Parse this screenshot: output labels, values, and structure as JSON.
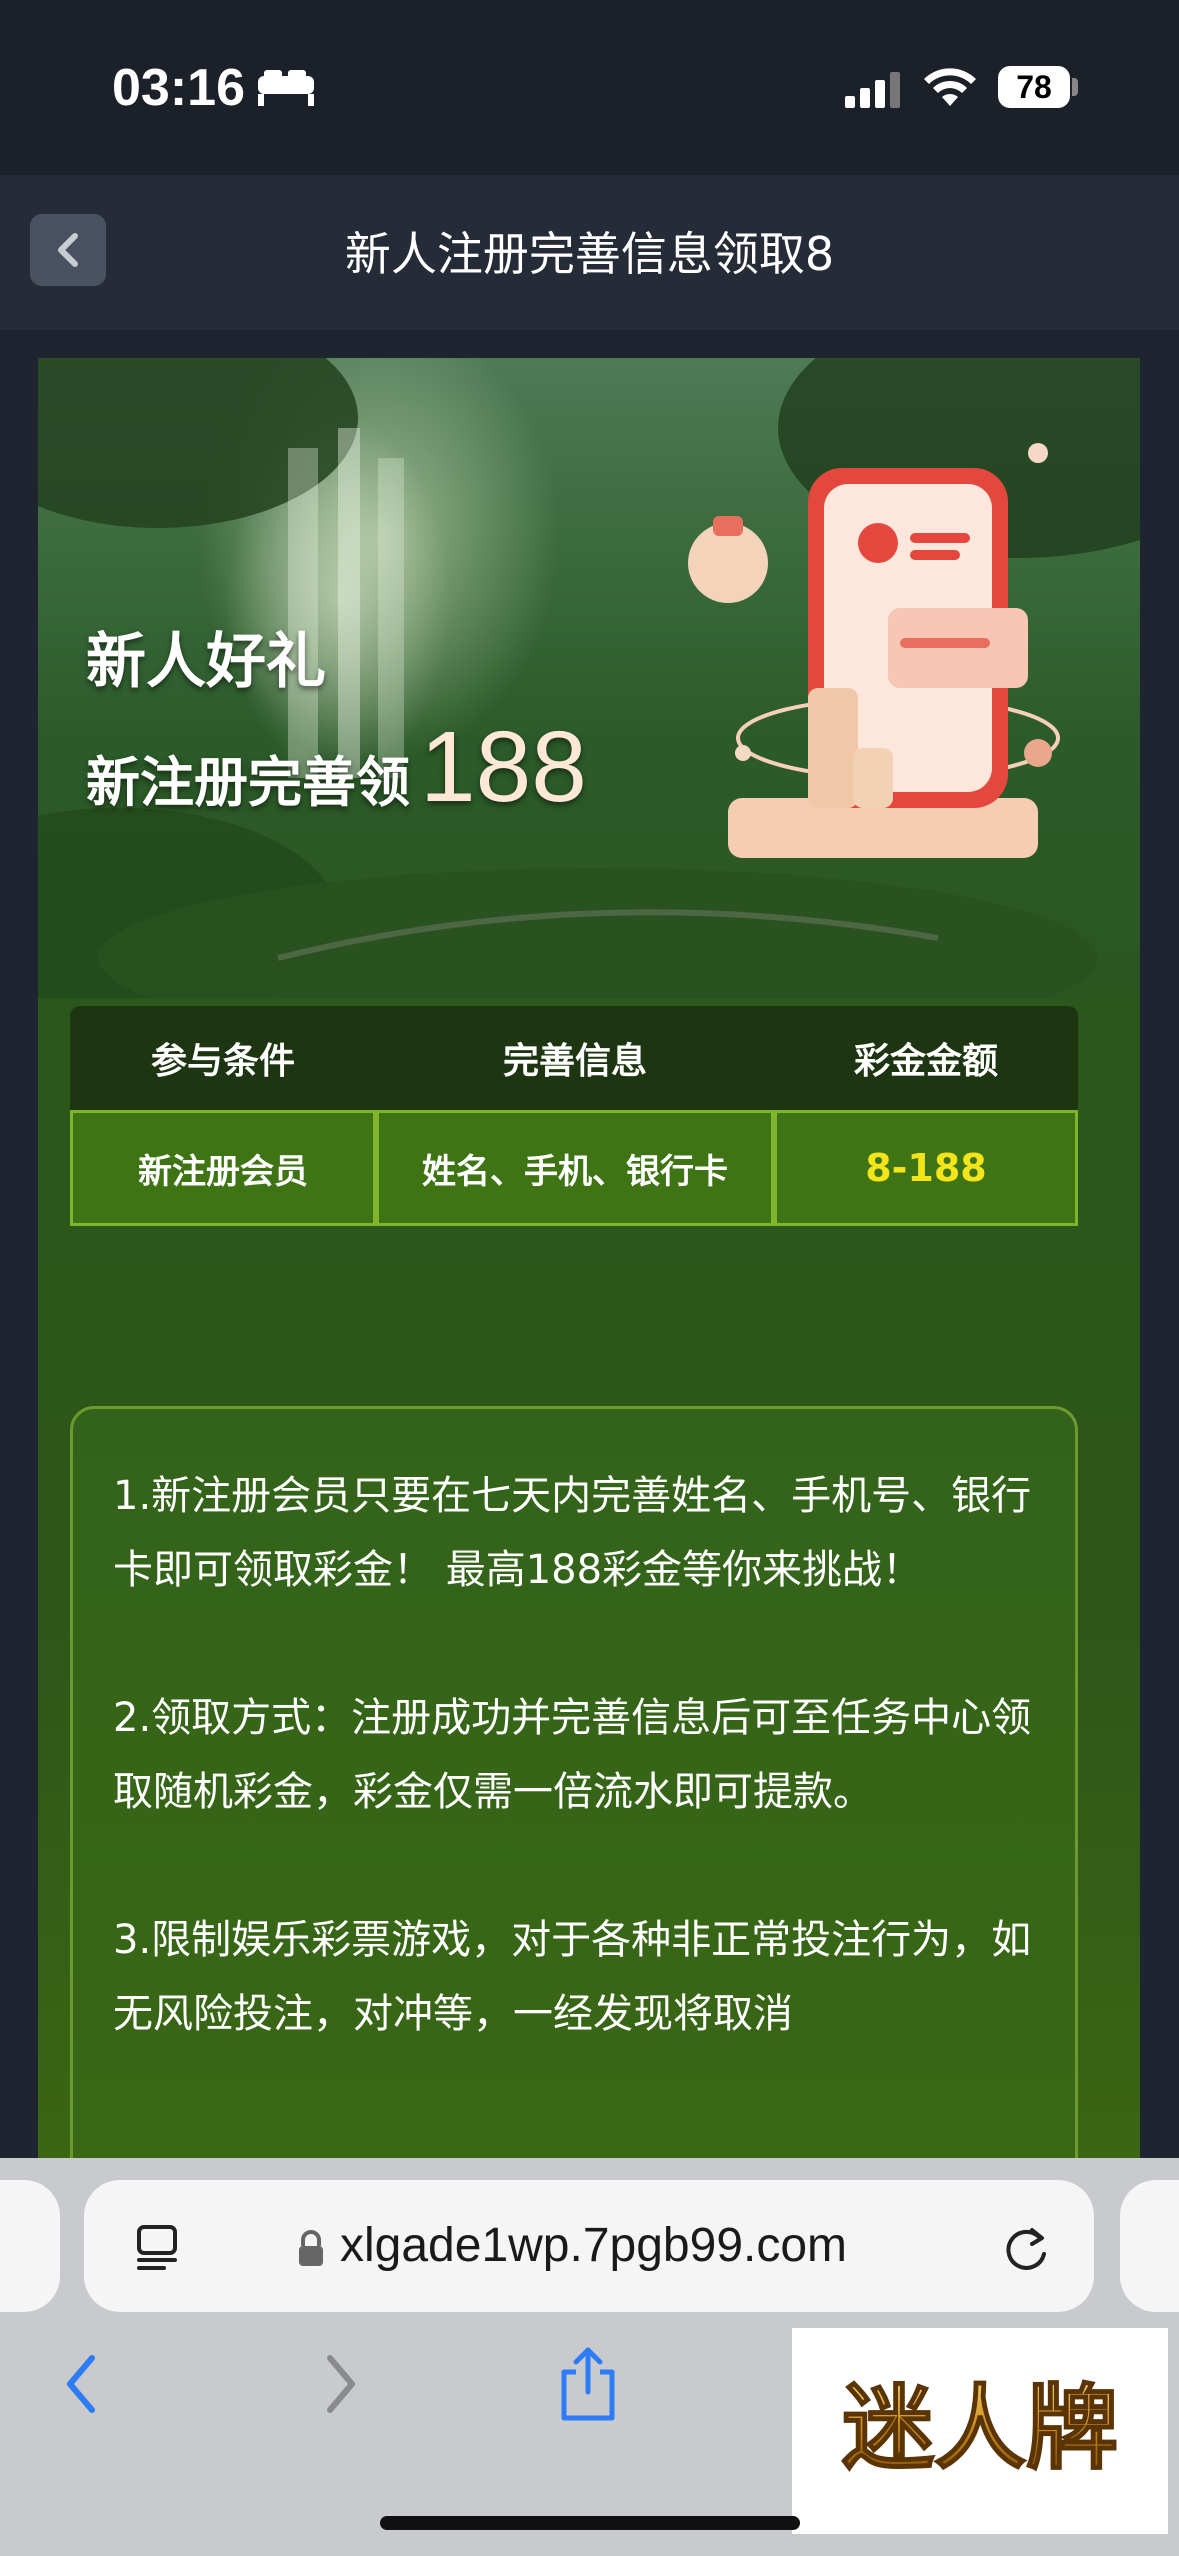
{
  "status_bar": {
    "time": "03:16",
    "battery": "78",
    "icons": [
      "bed-icon",
      "cellular-signal-icon",
      "wifi-icon",
      "battery-icon"
    ]
  },
  "nav": {
    "title": "新人注册完善信息领取8",
    "back_icon": "chevron-left-icon"
  },
  "banner": {
    "heading": "新人好礼",
    "subheading": "新注册完善领",
    "amount": "188"
  },
  "table": {
    "headers": [
      "参与条件",
      "完善信息",
      "彩金金额"
    ],
    "rows": [
      [
        "新注册会员",
        "姓名、手机、银行卡",
        "8-188"
      ]
    ],
    "amount_color": "#f4e41a"
  },
  "rules": [
    "1.新注册会员只要在七天内完善姓名、手机号、银行卡即可领取彩金！ 最高188彩金等你来挑战！",
    "2.领取方式：注册成功并完善信息后可至任务中心领取随机彩金，彩金仅需一倍流水即可提款。",
    "3.限制娱乐彩票游戏，对于各种非正常投注行为，如无风险投注，对冲等，一经发现将取消"
  ],
  "browser": {
    "url": "xlgade1wp.7pgb99.com",
    "icons": [
      "reader-icon",
      "lock-icon",
      "reload-icon",
      "back-arrow-icon",
      "forward-arrow-icon",
      "share-icon"
    ]
  },
  "watermark": {
    "text": "迷人牌"
  },
  "colors": {
    "accent_gold": "#f4e41a",
    "card_green": "#2e5618",
    "table_border": "#7eb52c"
  }
}
